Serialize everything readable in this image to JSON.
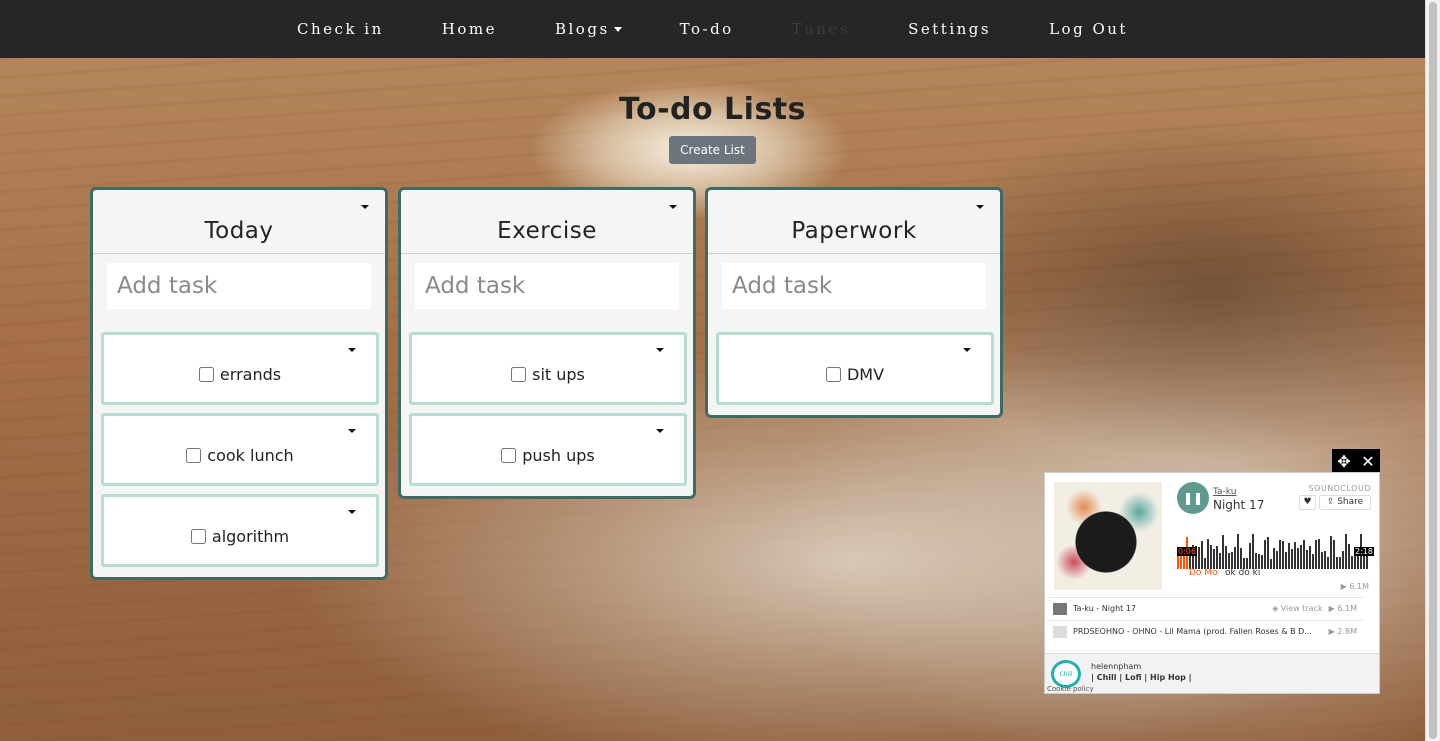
{
  "navbar": {
    "items": [
      {
        "label": "Check in"
      },
      {
        "label": "Home"
      },
      {
        "label": "Blogs"
      },
      {
        "label": "To-do"
      },
      {
        "label": "Tunes"
      },
      {
        "label": "Settings"
      },
      {
        "label": "Log Out"
      }
    ]
  },
  "page": {
    "title": "To-do Lists",
    "create_button": "Create List"
  },
  "lists": [
    {
      "name": "Today",
      "placeholder": "Add task",
      "tasks": [
        "errands",
        "cook lunch",
        "algorithm"
      ]
    },
    {
      "name": "Exercise",
      "placeholder": "Add task",
      "tasks": [
        "sit ups",
        "push ups"
      ]
    },
    {
      "name": "Paperwork",
      "placeholder": "Add task",
      "tasks": [
        "DMV"
      ]
    }
  ],
  "player": {
    "brand": "SOUNDCLOUD",
    "artist": "Ta-ku",
    "track": "Night 17",
    "like_icon": "heart-icon",
    "share_label": "Share",
    "time_elapsed": "0:06",
    "time_total": "2:18",
    "comment_user": "Do Mo",
    "comment_text": "ok do ki",
    "plays": "6.1M",
    "playlist": [
      {
        "title": "Ta-ku - Night 17",
        "action": "View track",
        "plays": "6.1M"
      },
      {
        "title": "PRDSEOHNO - OHNO - Lil Mama (prod. Fallen Roses & B D...",
        "action": "",
        "plays": "2.8M"
      }
    ],
    "footer": {
      "user": "helennpham",
      "tags": "| Chill | Lofi | Hip Hop |",
      "avatar_text": "Chill",
      "cookie": "Cookie policy"
    }
  }
}
